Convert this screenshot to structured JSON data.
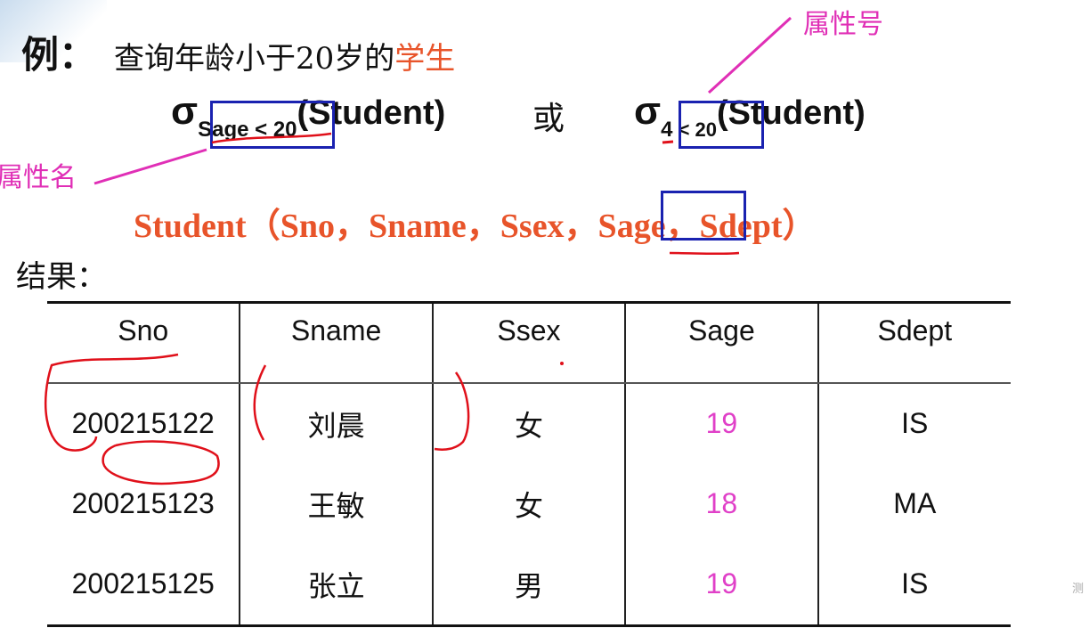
{
  "example": {
    "label": "例：",
    "text_prefix": "查询年龄小于20岁的",
    "text_highlight": "学生"
  },
  "selection_expr_1": {
    "sigma": "σ",
    "subscript": "Sage < 20",
    "relation": "(Student)"
  },
  "or_text": "或",
  "selection_expr_2": {
    "sigma": "σ",
    "subscript_index": "4",
    "subscript_cond": " < 20",
    "relation": "(Student)"
  },
  "annotations": {
    "attribute_number": "属性号",
    "attribute_name": "属性名"
  },
  "schema": "Student（Sno，Sname，Ssex，Sage，Sdept）",
  "result_label": "结果：",
  "table": {
    "headers": [
      "Sno",
      "Sname",
      "Ssex",
      "Sage",
      "Sdept"
    ],
    "rows": [
      [
        "200215122",
        "刘晨",
        "女",
        "19",
        "IS"
      ],
      [
        "200215123",
        "王敏",
        "女",
        "18",
        "MA"
      ],
      [
        "200215125",
        "张立",
        "男",
        "19",
        "IS"
      ]
    ]
  },
  "colors": {
    "highlight_orange": "#e8542a",
    "annotation_magenta": "#e02fb6",
    "age_value_magenta": "#e040c8",
    "box_blue": "#1a22b0",
    "pen_red": "#e0101a"
  },
  "watermark": "测"
}
